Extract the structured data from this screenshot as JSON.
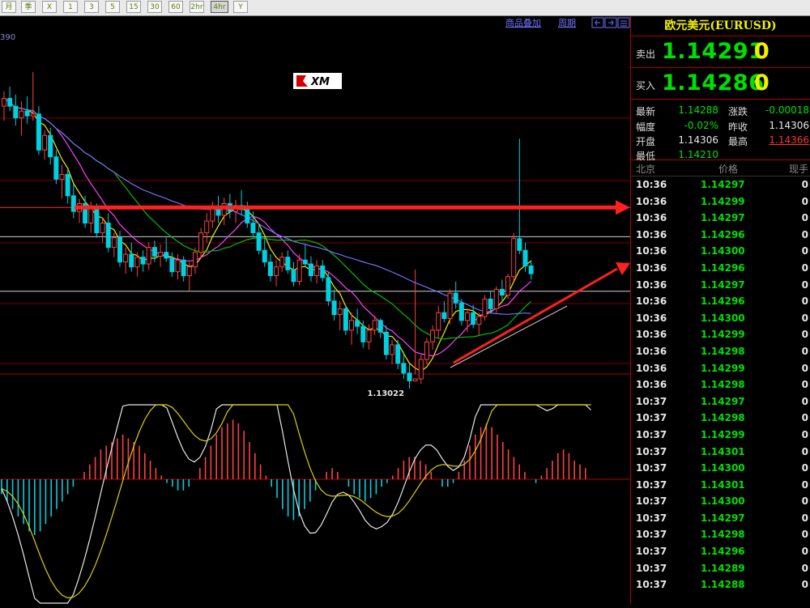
{
  "toolbar": {
    "buttons": [
      {
        "label": "月",
        "active": false
      },
      {
        "label": "季",
        "active": false
      },
      {
        "label": "X",
        "active": false
      },
      {
        "label": "1",
        "active": false
      },
      {
        "label": "3",
        "active": false
      },
      {
        "label": "5",
        "active": false
      },
      {
        "label": "15",
        "active": false
      },
      {
        "label": "30",
        "active": false
      },
      {
        "label": "60",
        "active": false
      },
      {
        "label": "2hr",
        "active": false
      },
      {
        "label": "4hr",
        "active": true
      },
      {
        "label": "Y",
        "active": false
      }
    ]
  },
  "chart_header": {
    "overlay_label": "商品叠加",
    "period_label": "周期",
    "value_readout": "390"
  },
  "watermark": "XM",
  "chart_data": {
    "type": "candlestick",
    "symbol": "EURUSD",
    "min_label": "1.13022",
    "candles": [
      [
        1.147,
        1.1485,
        1.1455,
        1.1478
      ],
      [
        1.1478,
        1.149,
        1.1465,
        1.147
      ],
      [
        1.147,
        1.1482,
        1.145,
        1.1458
      ],
      [
        1.1458,
        1.1475,
        1.144,
        1.1465
      ],
      [
        1.1465,
        1.148,
        1.1452,
        1.146
      ],
      [
        1.146,
        1.1505,
        1.1455,
        1.1462
      ],
      [
        1.1462,
        1.147,
        1.142,
        1.1425
      ],
      [
        1.1425,
        1.1445,
        1.1415,
        1.144
      ],
      [
        1.144,
        1.1448,
        1.141,
        1.1418
      ],
      [
        1.1418,
        1.1425,
        1.139,
        1.1395
      ],
      [
        1.1395,
        1.141,
        1.1375,
        1.14
      ],
      [
        1.14,
        1.1405,
        1.137,
        1.1378
      ],
      [
        1.1378,
        1.139,
        1.1355,
        1.1362
      ],
      [
        1.1362,
        1.1375,
        1.135,
        1.137
      ],
      [
        1.137,
        1.1378,
        1.1345,
        1.135
      ],
      [
        1.135,
        1.1372,
        1.134,
        1.1366
      ],
      [
        1.1366,
        1.137,
        1.1335,
        1.134
      ],
      [
        1.134,
        1.1355,
        1.133,
        1.135
      ],
      [
        1.135,
        1.136,
        1.132,
        1.1325
      ],
      [
        1.1325,
        1.134,
        1.1315,
        1.1335
      ],
      [
        1.1335,
        1.1342,
        1.1305,
        1.131
      ],
      [
        1.131,
        1.1325,
        1.1298,
        1.1318
      ],
      [
        1.1318,
        1.133,
        1.13,
        1.1305
      ],
      [
        1.1305,
        1.132,
        1.1295,
        1.1315
      ],
      [
        1.1315,
        1.1322,
        1.13,
        1.1308
      ],
      [
        1.1308,
        1.133,
        1.1302,
        1.1325
      ],
      [
        1.1325,
        1.1332,
        1.131,
        1.1316
      ],
      [
        1.1316,
        1.1328,
        1.1305,
        1.132
      ],
      [
        1.132,
        1.1335,
        1.131,
        1.1314
      ],
      [
        1.1314,
        1.132,
        1.1295,
        1.13
      ],
      [
        1.13,
        1.1318,
        1.1292,
        1.1312
      ],
      [
        1.1312,
        1.1316,
        1.129,
        1.1296
      ],
      [
        1.1296,
        1.131,
        1.128,
        1.1305
      ],
      [
        1.1305,
        1.1325,
        1.1298,
        1.132
      ],
      [
        1.132,
        1.1345,
        1.1315,
        1.134
      ],
      [
        1.134,
        1.136,
        1.133,
        1.1352
      ],
      [
        1.1352,
        1.1372,
        1.1345,
        1.1365
      ],
      [
        1.1365,
        1.1378,
        1.135,
        1.1358
      ],
      [
        1.1358,
        1.1376,
        1.1348,
        1.137
      ],
      [
        1.137,
        1.138,
        1.1355,
        1.1362
      ],
      [
        1.1362,
        1.1374,
        1.135,
        1.1368
      ],
      [
        1.1368,
        1.1384,
        1.1358,
        1.1364
      ],
      [
        1.1364,
        1.1372,
        1.1345,
        1.135
      ],
      [
        1.135,
        1.1362,
        1.1335,
        1.134
      ],
      [
        1.134,
        1.1348,
        1.1318,
        1.1322
      ],
      [
        1.1322,
        1.1335,
        1.1305,
        1.131
      ],
      [
        1.131,
        1.1318,
        1.129,
        1.1296
      ],
      [
        1.1296,
        1.1312,
        1.1285,
        1.1305
      ],
      [
        1.1305,
        1.132,
        1.13,
        1.1315
      ],
      [
        1.1315,
        1.1322,
        1.1298,
        1.1302
      ],
      [
        1.1302,
        1.131,
        1.1285,
        1.129
      ],
      [
        1.129,
        1.1318,
        1.1286,
        1.1312
      ],
      [
        1.1312,
        1.1328,
        1.1306,
        1.1308
      ],
      [
        1.1308,
        1.1316,
        1.129,
        1.1296
      ],
      [
        1.1296,
        1.1312,
        1.1288,
        1.1306
      ],
      [
        1.1306,
        1.1312,
        1.129,
        1.1294
      ],
      [
        1.1294,
        1.13,
        1.1265,
        1.127
      ],
      [
        1.127,
        1.1282,
        1.125,
        1.1256
      ],
      [
        1.1256,
        1.127,
        1.124,
        1.1262
      ],
      [
        1.1262,
        1.1266,
        1.1235,
        1.124
      ],
      [
        1.124,
        1.1258,
        1.1225,
        1.125
      ],
      [
        1.125,
        1.1262,
        1.1236,
        1.1244
      ],
      [
        1.1244,
        1.125,
        1.1222,
        1.1228
      ],
      [
        1.1228,
        1.1246,
        1.122,
        1.124
      ],
      [
        1.124,
        1.1255,
        1.1235,
        1.125
      ],
      [
        1.125,
        1.1252,
        1.1232,
        1.1238
      ],
      [
        1.1238,
        1.1245,
        1.121,
        1.1215
      ],
      [
        1.1215,
        1.123,
        1.1205,
        1.1225
      ],
      [
        1.1225,
        1.123,
        1.12,
        1.1206
      ],
      [
        1.1206,
        1.1218,
        1.119,
        1.1196
      ],
      [
        1.1196,
        1.1205,
        1.118,
        1.1188
      ],
      [
        1.1188,
        1.1195,
        1.13022,
        1.119
      ],
      [
        1.119,
        1.1215,
        1.1185,
        1.121
      ],
      [
        1.121,
        1.1232,
        1.1205,
        1.1228
      ],
      [
        1.1228,
        1.1245,
        1.122,
        1.124
      ],
      [
        1.124,
        1.1265,
        1.1232,
        1.1258
      ],
      [
        1.1258,
        1.127,
        1.1248,
        1.1252
      ],
      [
        1.1252,
        1.1282,
        1.1246,
        1.1278
      ],
      [
        1.1278,
        1.129,
        1.1262,
        1.1268
      ],
      [
        1.1268,
        1.1272,
        1.1245,
        1.125
      ],
      [
        1.125,
        1.1262,
        1.1238,
        1.1258
      ],
      [
        1.1258,
        1.1266,
        1.1242,
        1.1246
      ],
      [
        1.1246,
        1.1258,
        1.1235,
        1.1254
      ],
      [
        1.1254,
        1.1276,
        1.125,
        1.1272
      ],
      [
        1.1272,
        1.128,
        1.1258,
        1.1262
      ],
      [
        1.1262,
        1.1285,
        1.1258,
        1.1282
      ],
      [
        1.1282,
        1.1292,
        1.1268,
        1.1276
      ],
      [
        1.1276,
        1.1298,
        1.1272,
        1.1295
      ],
      [
        1.1295,
        1.134,
        1.129,
        1.1334
      ],
      [
        1.1334,
        1.14366,
        1.1318,
        1.1322
      ],
      [
        1.1322,
        1.133,
        1.13,
        1.1306
      ],
      [
        1.1306,
        1.1312,
        1.1292,
        1.1298
      ]
    ],
    "moving_averages": [
      {
        "name": "MA5",
        "color": "#f0f000"
      },
      {
        "name": "MA10",
        "color": "#ff40ff"
      },
      {
        "name": "MA20",
        "color": "#00c000"
      },
      {
        "name": "MA40",
        "color": "#7070ff"
      }
    ],
    "horizontal_levels": [
      {
        "price": 1.1366,
        "color": "#ff3030"
      },
      {
        "price": 1.1336,
        "color": "#cfcfcf"
      },
      {
        "price": 1.128,
        "color": "#cfcfcf"
      }
    ],
    "indicator": {
      "type": "MACD",
      "histogram": [
        -4,
        -6,
        -8,
        -10,
        -12,
        -14,
        -15,
        -14,
        -12,
        -10,
        -8,
        -6,
        -4,
        -2,
        0,
        2,
        4,
        6,
        8,
        9,
        10,
        11,
        12,
        11,
        10,
        9,
        7,
        5,
        3,
        1,
        -1,
        -2,
        -3,
        -3,
        -2,
        0,
        3,
        6,
        9,
        12,
        14,
        15,
        16,
        15,
        13,
        10,
        7,
        4,
        1,
        -2,
        -5,
        -8,
        -10,
        -11,
        -10,
        -8,
        -6,
        -3,
        0,
        2,
        3,
        2,
        0,
        -2,
        -4,
        -5,
        -6,
        -5,
        -4,
        -2,
        -1,
        1,
        3,
        5,
        6,
        6,
        5,
        4,
        2,
        0,
        -2,
        -2,
        -1,
        2,
        5,
        9,
        12,
        14,
        15,
        14,
        12,
        10,
        8,
        6,
        4,
        2,
        0,
        -1,
        1,
        3,
        5,
        7,
        8,
        7,
        5,
        4,
        3,
        0
      ]
    }
  },
  "panel": {
    "title": "欧元美元(EURUSD)",
    "sell_label": "卖出",
    "sell_price": "1.14291",
    "sell_suffix": "0",
    "buy_label": "买入",
    "buy_price": "1.14286",
    "buy_suffix": "0",
    "stats": {
      "latest_label": "最新",
      "latest": "1.14288",
      "change_label": "涨跌",
      "change": "-0.00018",
      "range_label": "幅度",
      "range": "-0.02%",
      "prevclose_label": "昨收",
      "prevclose": "1.14306",
      "open_label": "开盘",
      "open": "1.14306",
      "high_label": "最高",
      "high": "1.14366",
      "low_label": "最低",
      "low": "1.14210"
    },
    "tick_header": {
      "time": "北京",
      "price": "价格",
      "volume": "现手"
    },
    "ticks": [
      {
        "time": "10:36",
        "price": "1.14297",
        "vol": "0"
      },
      {
        "time": "10:36",
        "price": "1.14299",
        "vol": "0"
      },
      {
        "time": "10:36",
        "price": "1.14297",
        "vol": "0"
      },
      {
        "time": "10:36",
        "price": "1.14296",
        "vol": "0"
      },
      {
        "time": "10:36",
        "price": "1.14300",
        "vol": "0"
      },
      {
        "time": "10:36",
        "price": "1.14296",
        "vol": "0"
      },
      {
        "time": "10:36",
        "price": "1.14297",
        "vol": "0"
      },
      {
        "time": "10:36",
        "price": "1.14296",
        "vol": "0"
      },
      {
        "time": "10:36",
        "price": "1.14300",
        "vol": "0"
      },
      {
        "time": "10:36",
        "price": "1.14299",
        "vol": "0"
      },
      {
        "time": "10:36",
        "price": "1.14298",
        "vol": "0"
      },
      {
        "time": "10:36",
        "price": "1.14299",
        "vol": "0"
      },
      {
        "time": "10:36",
        "price": "1.14298",
        "vol": "0"
      },
      {
        "time": "10:37",
        "price": "1.14297",
        "vol": "0"
      },
      {
        "time": "10:37",
        "price": "1.14298",
        "vol": "0"
      },
      {
        "time": "10:37",
        "price": "1.14299",
        "vol": "0"
      },
      {
        "time": "10:37",
        "price": "1.14301",
        "vol": "0"
      },
      {
        "time": "10:37",
        "price": "1.14300",
        "vol": "0"
      },
      {
        "time": "10:37",
        "price": "1.14301",
        "vol": "0"
      },
      {
        "time": "10:37",
        "price": "1.14300",
        "vol": "0"
      },
      {
        "time": "10:37",
        "price": "1.14297",
        "vol": "0"
      },
      {
        "time": "10:37",
        "price": "1.14298",
        "vol": "0"
      },
      {
        "time": "10:37",
        "price": "1.14296",
        "vol": "0"
      },
      {
        "time": "10:37",
        "price": "1.14289",
        "vol": "0"
      },
      {
        "time": "10:37",
        "price": "1.14288",
        "vol": "0"
      }
    ]
  },
  "colors": {
    "up": "#ff4040",
    "down": "#00d0e0",
    "grid": "#7a0000",
    "price_up": "#00e000",
    "highlight": "#ff3030"
  }
}
